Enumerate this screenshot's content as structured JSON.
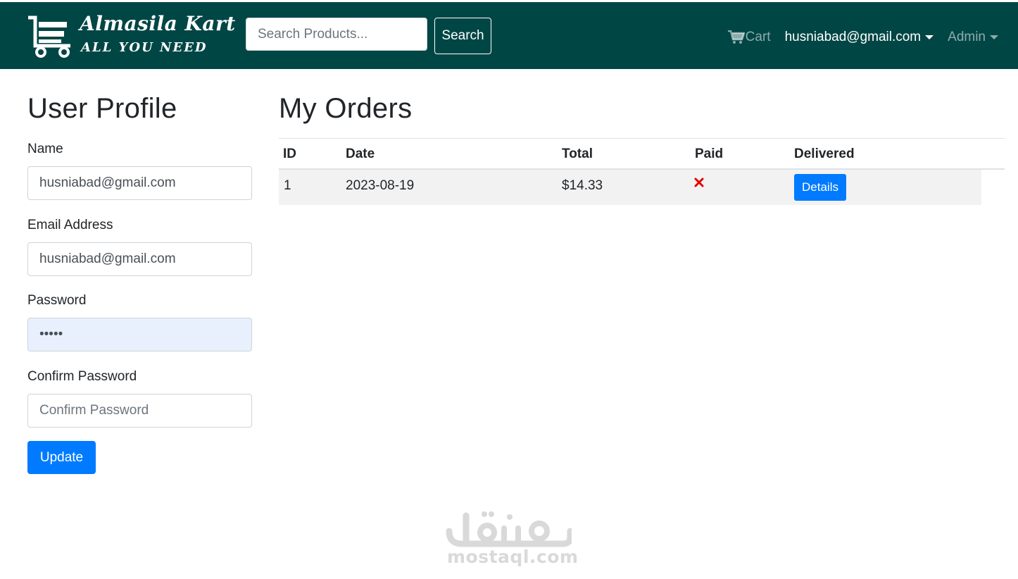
{
  "brand": {
    "name": "Almasila Kart",
    "tagline": "ALL YOU NEED"
  },
  "search": {
    "placeholder": "Search Products...",
    "button_label": "Search"
  },
  "nav": {
    "cart_label": "Cart",
    "user_label": "husniabad@gmail.com",
    "admin_label": "Admin"
  },
  "profile": {
    "title": "User Profile",
    "name_label": "Name",
    "name_value": "husniabad@gmail.com",
    "email_label": "Email Address",
    "email_value": "husniabad@gmail.com",
    "password_label": "Password",
    "password_value": "•••••",
    "confirm_label": "Confirm Password",
    "confirm_placeholder": "Confirm Password",
    "update_label": "Update"
  },
  "orders": {
    "title": "My Orders",
    "columns": [
      "ID",
      "Date",
      "Total",
      "Paid",
      "Delivered"
    ],
    "rows": [
      {
        "id": "1",
        "date": "2023-08-19",
        "total": "$14.33",
        "paid": "not-paid-x-icon",
        "details_label": "Details"
      }
    ]
  },
  "watermark": {
    "arabic": "مستقل",
    "text": "mostaql.com"
  },
  "colors": {
    "navbar": "#004645",
    "primary": "#007bff",
    "unpaid": "#e60000",
    "row_stripe": "#f2f2f2"
  }
}
